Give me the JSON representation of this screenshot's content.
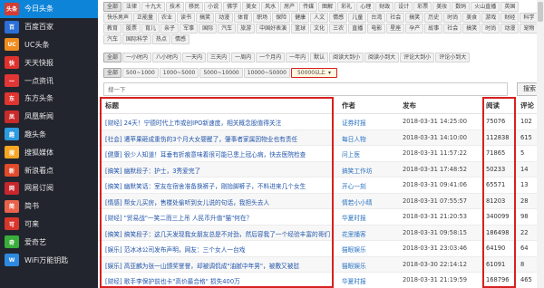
{
  "sidebar": {
    "items": [
      {
        "label": "今日头条",
        "icon": "toutiao-icon",
        "badge": "头条",
        "color": "#d43c33",
        "active": true
      },
      {
        "label": "百度百家",
        "icon": "baidu-icon",
        "badge": "百",
        "color": "#2b6fd7",
        "active": false
      },
      {
        "label": "UC头条",
        "icon": "uc-icon",
        "badge": "UC",
        "color": "#f08c1f",
        "active": false
      },
      {
        "label": "天天快报",
        "icon": "kuaibao-icon",
        "badge": "快",
        "color": "#e0322c",
        "active": false
      },
      {
        "label": "一点资讯",
        "icon": "yidian-icon",
        "badge": "一",
        "color": "#e23636",
        "active": false
      },
      {
        "label": "东方头条",
        "icon": "dongfang-icon",
        "badge": "东",
        "color": "#e0342f",
        "active": false
      },
      {
        "label": "凤凰新闻",
        "icon": "ifeng-icon",
        "badge": "凤",
        "color": "#c92a2a",
        "active": false
      },
      {
        "label": "趣头条",
        "icon": "qutoutiao-icon",
        "badge": "趣",
        "color": "#2c9be0",
        "active": false
      },
      {
        "label": "搜狐媒体",
        "icon": "sohu-icon",
        "badge": "搜",
        "color": "#f5a623",
        "active": false
      },
      {
        "label": "新浪看点",
        "icon": "sina-icon",
        "badge": "新",
        "color": "#e14b2c",
        "active": false
      },
      {
        "label": "网易订阅",
        "icon": "netease-icon",
        "badge": "网",
        "color": "#c8262c",
        "active": false
      },
      {
        "label": "简书",
        "icon": "jianshu-icon",
        "badge": "简",
        "color": "#e9624b",
        "active": false
      },
      {
        "label": "可来",
        "icon": "kelai-icon",
        "badge": "可",
        "color": "#d9352b",
        "active": false
      },
      {
        "label": "爱奇艺",
        "icon": "iqiyi-icon",
        "badge": "奇",
        "color": "#3aae3a",
        "active": false
      },
      {
        "label": "WiFi万能钥匙",
        "icon": "wifi-icon",
        "badge": "W",
        "color": "#2d8ae0",
        "active": false
      }
    ]
  },
  "categories": {
    "row1": [
      "全部",
      "法律",
      "十九大",
      "技术",
      "移民",
      "小说",
      "佛学",
      "美女",
      "风水",
      "房产",
      "传媒",
      "图解",
      "彩礼",
      "心理",
      "财政",
      "设计",
      "彩票",
      "美妆",
      "数码"
    ],
    "row2": [
      "火山直播",
      "英国",
      "快乐男声",
      "正能量",
      "农业",
      "读书",
      "搞笑",
      "动漫",
      "体育",
      "职场",
      "保险",
      "健康",
      "人文",
      "情感",
      "儿童",
      "台湾",
      "社会",
      "搞笑",
      "历史",
      "时尚",
      "美食"
    ],
    "row3": [
      "游戏",
      "财经",
      "科学",
      "教育",
      "股票",
      "育儿",
      "亲子",
      "军事",
      "国际",
      "汽车",
      "旅游",
      "中国好表演",
      "篮球",
      "文化",
      "三农",
      "直播",
      "电影",
      "星座"
    ],
    "row4": [
      "孕产",
      "故事",
      "社会",
      "搞笑",
      "时尚",
      "动漫",
      "宠物",
      "汽车",
      "国际科学",
      "热点",
      "情感"
    ],
    "selected": "全部"
  },
  "time_filter": {
    "options": [
      "全部",
      "一小时内",
      "八小时内",
      "一天内",
      "三天内",
      "一周内",
      "一个月内",
      "一年内",
      "默认",
      "阅读大到小",
      "阅读小到大",
      "评论大到小",
      "评论小到大"
    ],
    "selected": "全部"
  },
  "read_filter": {
    "options": [
      "全部",
      "500~1000",
      "1000~5000",
      "5000~10000",
      "10000~50000",
      "50000以上"
    ],
    "selected": "50000以上",
    "selected_marker": "▾"
  },
  "search": {
    "placeholder": "搜一下",
    "button": "搜索"
  },
  "table": {
    "columns": {
      "title": "标题",
      "author": "作者",
      "date": "发布",
      "reads": "阅读",
      "comments": "评论"
    },
    "rows": [
      {
        "title": "[财经] 24天！宁德时代上市或创IPO新速度，相关概念股值得关注",
        "author": "证券时报",
        "date": "2018-03-31 14:25:00",
        "reads": "75076",
        "comments": "102"
      },
      {
        "title": "[社会] 遭苹果砸成重伤的3个月大女婴醒了，肇事者家属因物业也有责任",
        "author": "每日人物",
        "date": "2018-03-31 14:10:00",
        "reads": "112838",
        "comments": "615"
      },
      {
        "title": "[健康] 很少人知道！耳垂有折痕意味着很可能已患上冠心病，快去医院检查",
        "author": "问上医",
        "date": "2018-03-31 11:57:22",
        "reads": "71865",
        "comments": "5"
      },
      {
        "title": "[搞笑] 幽默段子：护士，3秀爱完了",
        "author": "搞笑工作坊",
        "date": "2018-03-31 17:48:52",
        "reads": "50233",
        "comments": "14"
      },
      {
        "title": "[搞笑] 幽默笑话：室友在宿舍准备换裤子，刚抬脚裤子，不料进来几个女生",
        "author": "开心一刻",
        "date": "2018-03-31 09:41:06",
        "reads": "65571",
        "comments": "13"
      },
      {
        "title": "[情感] 帮女儿买房，售楼处偷听到女儿说的句话，我担头去人",
        "author": "情若小小晴",
        "date": "2018-03-31 07:55:57",
        "reads": "81203",
        "comments": "28"
      },
      {
        "title": "[财经] \"贸易战\"一笑二而三上吊 人民币升值\"猫\"何在？",
        "author": "华夏时报",
        "date": "2018-03-31 21:20:53",
        "reads": "340099",
        "comments": "98"
      },
      {
        "title": "[搞笑] 搞笑段子：这几天发现我女朋友总是不对劲，然后容我了一个经验丰富的哥们",
        "author": "花里播客",
        "date": "2018-03-31 09:58:15",
        "reads": "186498",
        "comments": "22"
      },
      {
        "title": "[娱乐] 范冰冰公司发布声明，网友：三个女人一台戏",
        "author": "猫眼娱乐",
        "date": "2018-03-31 23:03:46",
        "reads": "64190",
        "comments": "64"
      },
      {
        "title": "[娱乐] 高亚麟为张一山颁奖誉誉，却被调侃成\"油腻中年男\"，被敷又被怼",
        "author": "猫眼娱乐",
        "date": "2018-03-30 22:14:12",
        "reads": "61091",
        "comments": "8"
      },
      {
        "title": "[财经] 歌手李保护前也卡\"高价最合格\" 损失400万",
        "author": "华夏时报",
        "date": "2018-03-31 21:19:59",
        "reads": "168796",
        "comments": "465"
      }
    ]
  },
  "colors": {
    "sidebar_bg": "#22252e",
    "sidebar_active": "#0e84d8",
    "highlight_red": "#d72020",
    "link": "#2255aa"
  }
}
